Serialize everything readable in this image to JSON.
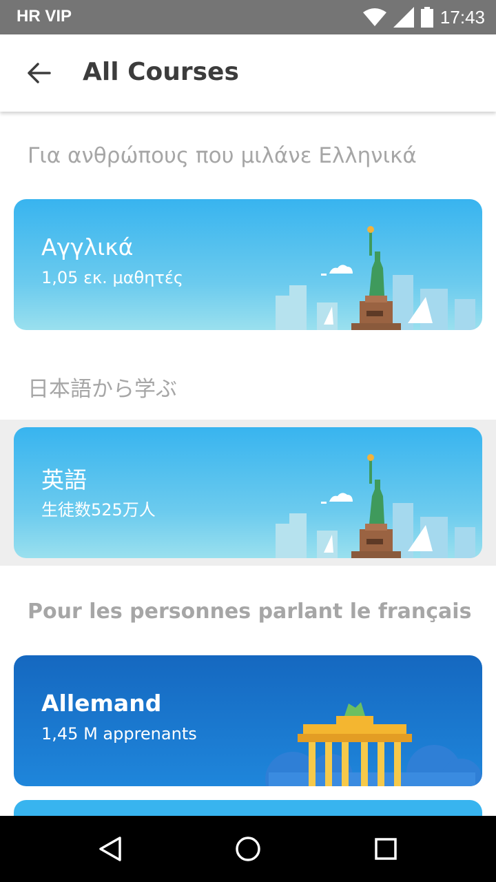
{
  "status_bar": {
    "carrier": "HR VIP",
    "time": "17:43"
  },
  "app_bar": {
    "title": "All Courses"
  },
  "sections": [
    {
      "header": "Για ανθρώπους που μιλάνε Ελληνικά",
      "course": {
        "name": "Αγγλικά",
        "learners": "1,05 εκ. μαθητές",
        "illustration": "statue-of-liberty"
      }
    },
    {
      "header": "日本語から学ぶ",
      "course": {
        "name": "英語",
        "learners": "生徒数525万人",
        "illustration": "statue-of-liberty"
      }
    },
    {
      "header": "Pour les personnes parlant le français",
      "course": {
        "name": "Allemand",
        "learners": "1,45 M apprenants",
        "illustration": "brandenburg-gate"
      }
    }
  ],
  "colors": {
    "card_light": "#38b4ef",
    "card_dark": "#1568c0",
    "header_text": "#a6a6a6",
    "title_text": "#3c3c3c"
  },
  "nav": {
    "back": "triangle-back-icon",
    "home": "circle-home-icon",
    "recents": "square-recents-icon"
  }
}
